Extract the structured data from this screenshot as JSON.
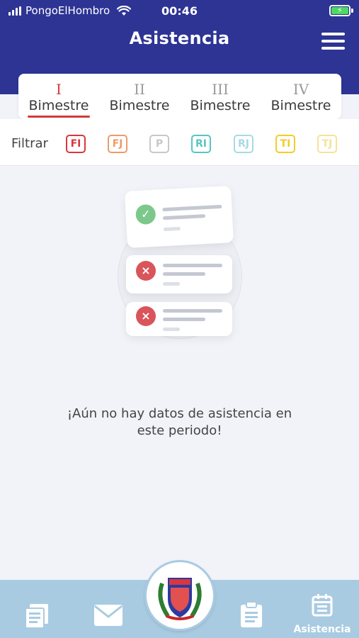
{
  "status_bar": {
    "carrier": "PongoElHombro",
    "time": "00:46"
  },
  "header": {
    "title": "Asistencia"
  },
  "tabs": [
    {
      "numeral": "I",
      "label": "Bimestre",
      "active": true
    },
    {
      "numeral": "II",
      "label": "Bimestre",
      "active": false
    },
    {
      "numeral": "III",
      "label": "Bimestre",
      "active": false
    },
    {
      "numeral": "IV",
      "label": "Bimestre",
      "active": false
    }
  ],
  "filter": {
    "label": "Filtrar",
    "chips": [
      {
        "code": "FI",
        "color": "#d9363e"
      },
      {
        "code": "FJ",
        "color": "#ef9a6a"
      },
      {
        "code": "P",
        "color": "#c8c8c8"
      },
      {
        "code": "RI",
        "color": "#56c6c0"
      },
      {
        "code": "RJ",
        "color": "#a6dbe4"
      },
      {
        "code": "TI",
        "color": "#f2cc2c"
      },
      {
        "code": "TJ",
        "color": "#f4e39a"
      }
    ]
  },
  "empty_state": {
    "message_line1": "¡Aún no hay datos de asistencia en",
    "message_line2": "este periodo!",
    "icons": [
      "check-icon",
      "cross-icon",
      "cross-icon"
    ]
  },
  "bottom_nav": {
    "items": [
      "news-icon",
      "mail-icon",
      "school-crest",
      "clipboard-icon",
      "calendar-icon"
    ],
    "active_label": "Asistencia"
  },
  "colors": {
    "header": "#2d3494",
    "accent": "#d33a3a",
    "nav": "#a9cbe2"
  }
}
